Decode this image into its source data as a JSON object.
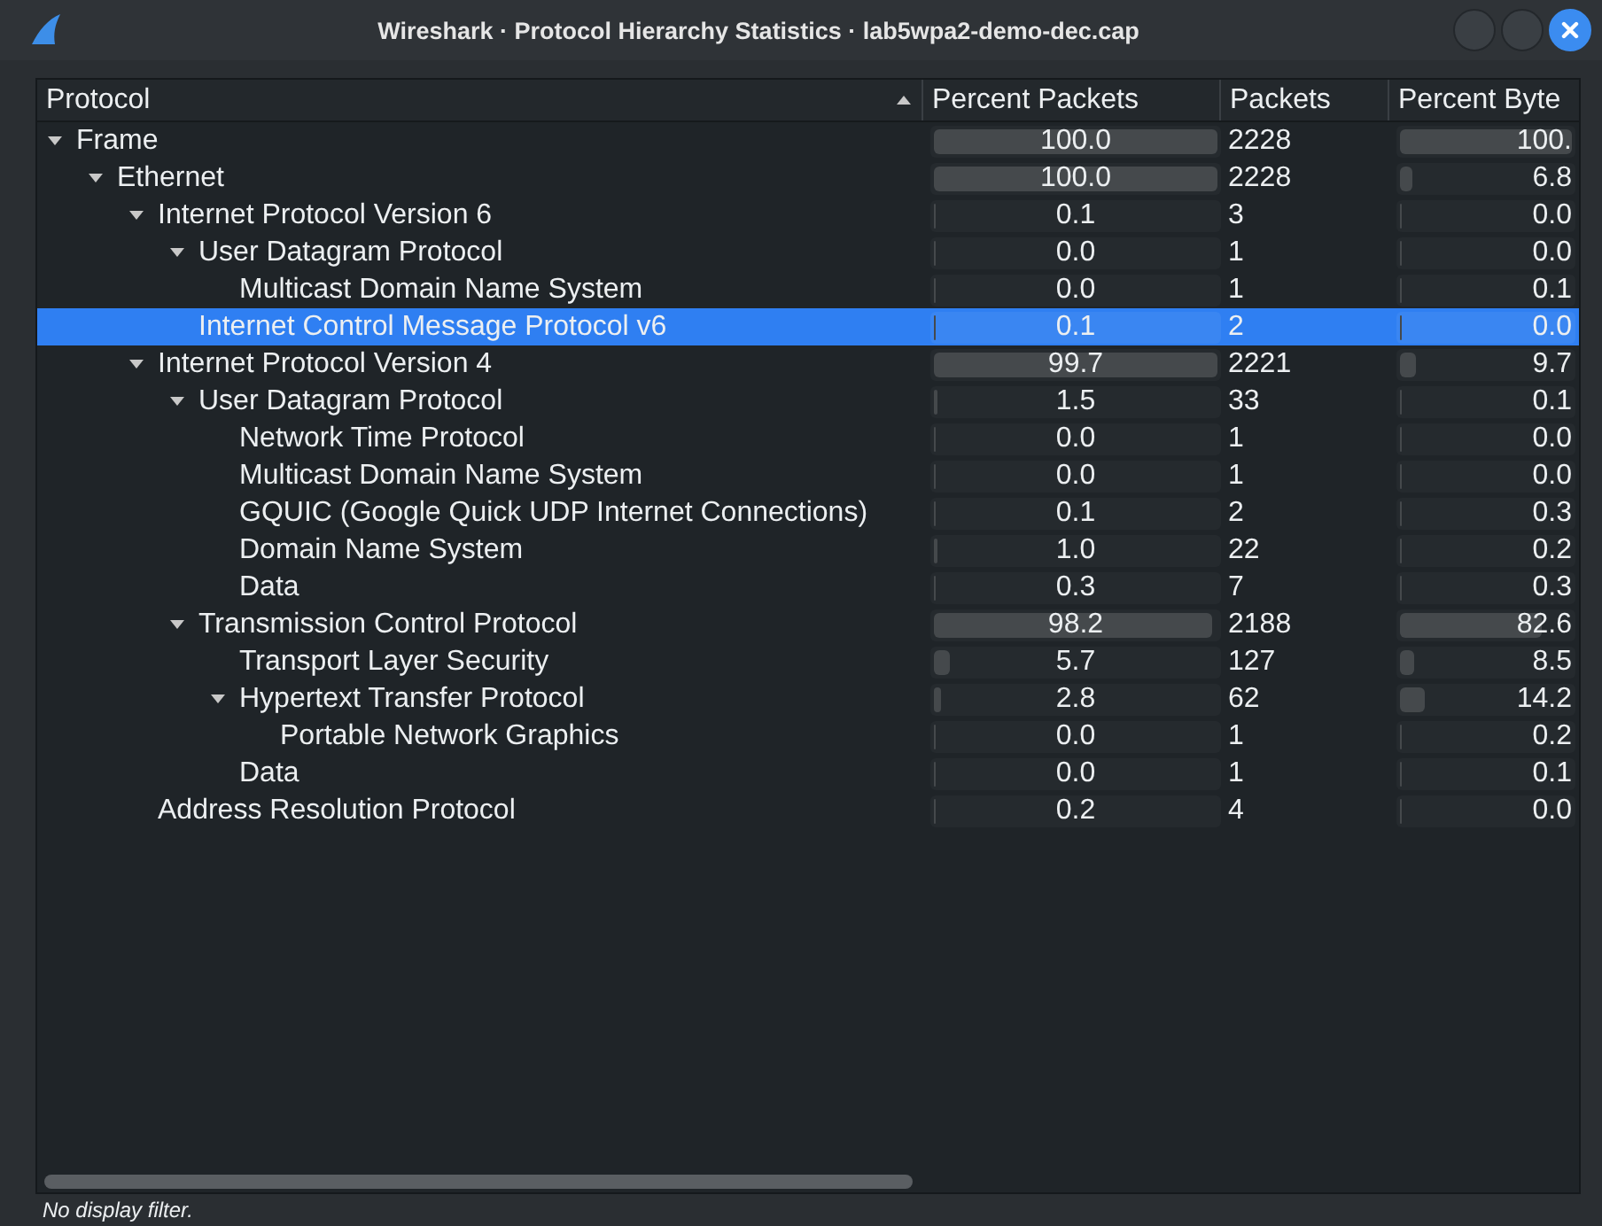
{
  "window": {
    "title": "Wireshark · Protocol Hierarchy Statistics · lab5wpa2-demo-dec.cap"
  },
  "table": {
    "columns": [
      "Protocol",
      "Percent Packets",
      "Packets",
      "Percent Byte"
    ],
    "rows": [
      {
        "protocol": "Frame",
        "expanded": true,
        "selected": false,
        "percent_packets": {
          "text": "100.0",
          "level": 1.0
        },
        "packets": "2228",
        "percent_bytes": {
          "text": "100.",
          "level": 1.0
        },
        "children": [
          {
            "protocol": "Ethernet",
            "expanded": true,
            "selected": false,
            "percent_packets": {
              "text": "100.0",
              "level": 1.0
            },
            "packets": "2228",
            "percent_bytes": {
              "text": "6.8",
              "level": 0.068
            },
            "children": [
              {
                "protocol": "Internet Protocol Version 6",
                "expanded": true,
                "selected": false,
                "percent_packets": {
                  "text": "0.1",
                  "level": 0.001
                },
                "packets": "3",
                "percent_bytes": {
                  "text": "0.0",
                  "level": 0.0
                },
                "children": [
                  {
                    "protocol": "User Datagram Protocol",
                    "expanded": true,
                    "selected": false,
                    "percent_packets": {
                      "text": "0.0",
                      "level": 0.0
                    },
                    "packets": "1",
                    "percent_bytes": {
                      "text": "0.0",
                      "level": 0.0
                    },
                    "children": [
                      {
                        "protocol": "Multicast Domain Name System",
                        "selected": false,
                        "percent_packets": {
                          "text": "0.0",
                          "level": 0.0
                        },
                        "packets": "1",
                        "percent_bytes": {
                          "text": "0.1",
                          "level": 0.001
                        }
                      }
                    ]
                  },
                  {
                    "protocol": "Internet Control Message Protocol v6",
                    "selected": true,
                    "percent_packets": {
                      "text": "0.1",
                      "level": 0.001
                    },
                    "packets": "2",
                    "percent_bytes": {
                      "text": "0.0",
                      "level": 0.0
                    }
                  }
                ]
              },
              {
                "protocol": "Internet Protocol Version 4",
                "expanded": true,
                "selected": false,
                "percent_packets": {
                  "text": "99.7",
                  "level": 0.997
                },
                "packets": "2221",
                "percent_bytes": {
                  "text": "9.7",
                  "level": 0.097
                },
                "children": [
                  {
                    "protocol": "User Datagram Protocol",
                    "expanded": true,
                    "selected": false,
                    "percent_packets": {
                      "text": "1.5",
                      "level": 0.015
                    },
                    "packets": "33",
                    "percent_bytes": {
                      "text": "0.1",
                      "level": 0.001
                    },
                    "children": [
                      {
                        "protocol": "Network Time Protocol",
                        "selected": false,
                        "percent_packets": {
                          "text": "0.0",
                          "level": 0.0
                        },
                        "packets": "1",
                        "percent_bytes": {
                          "text": "0.0",
                          "level": 0.0
                        }
                      },
                      {
                        "protocol": "Multicast Domain Name System",
                        "selected": false,
                        "percent_packets": {
                          "text": "0.0",
                          "level": 0.0
                        },
                        "packets": "1",
                        "percent_bytes": {
                          "text": "0.0",
                          "level": 0.0
                        }
                      },
                      {
                        "protocol": "GQUIC (Google Quick UDP Internet Connections)",
                        "selected": false,
                        "percent_packets": {
                          "text": "0.1",
                          "level": 0.001
                        },
                        "packets": "2",
                        "percent_bytes": {
                          "text": "0.3",
                          "level": 0.003
                        }
                      },
                      {
                        "protocol": "Domain Name System",
                        "selected": false,
                        "percent_packets": {
                          "text": "1.0",
                          "level": 0.01
                        },
                        "packets": "22",
                        "percent_bytes": {
                          "text": "0.2",
                          "level": 0.002
                        }
                      },
                      {
                        "protocol": "Data",
                        "selected": false,
                        "percent_packets": {
                          "text": "0.3",
                          "level": 0.003
                        },
                        "packets": "7",
                        "percent_bytes": {
                          "text": "0.3",
                          "level": 0.003
                        }
                      }
                    ]
                  },
                  {
                    "protocol": "Transmission Control Protocol",
                    "expanded": true,
                    "selected": false,
                    "percent_packets": {
                      "text": "98.2",
                      "level": 0.982
                    },
                    "packets": "2188",
                    "percent_bytes": {
                      "text": "82.6",
                      "level": 0.826
                    },
                    "children": [
                      {
                        "protocol": "Transport Layer Security",
                        "selected": false,
                        "percent_packets": {
                          "text": "5.7",
                          "level": 0.057
                        },
                        "packets": "127",
                        "percent_bytes": {
                          "text": "8.5",
                          "level": 0.085
                        }
                      },
                      {
                        "protocol": "Hypertext Transfer Protocol",
                        "expanded": true,
                        "selected": false,
                        "percent_packets": {
                          "text": "2.8",
                          "level": 0.028
                        },
                        "packets": "62",
                        "percent_bytes": {
                          "text": "14.2",
                          "level": 0.142
                        },
                        "children": [
                          {
                            "protocol": "Portable Network Graphics",
                            "selected": false,
                            "percent_packets": {
                              "text": "0.0",
                              "level": 0.0
                            },
                            "packets": "1",
                            "percent_bytes": {
                              "text": "0.2",
                              "level": 0.002
                            }
                          }
                        ]
                      },
                      {
                        "protocol": "Data",
                        "selected": false,
                        "percent_packets": {
                          "text": "0.0",
                          "level": 0.0
                        },
                        "packets": "1",
                        "percent_bytes": {
                          "text": "0.1",
                          "level": 0.001
                        }
                      }
                    ]
                  }
                ]
              },
              {
                "protocol": "Address Resolution Protocol",
                "selected": false,
                "percent_packets": {
                  "text": "0.2",
                  "level": 0.002
                },
                "packets": "4",
                "percent_bytes": {
                  "text": "0.0",
                  "level": 0.0
                }
              }
            ]
          }
        ]
      }
    ]
  },
  "status_bar": {
    "text": "No display filter."
  }
}
